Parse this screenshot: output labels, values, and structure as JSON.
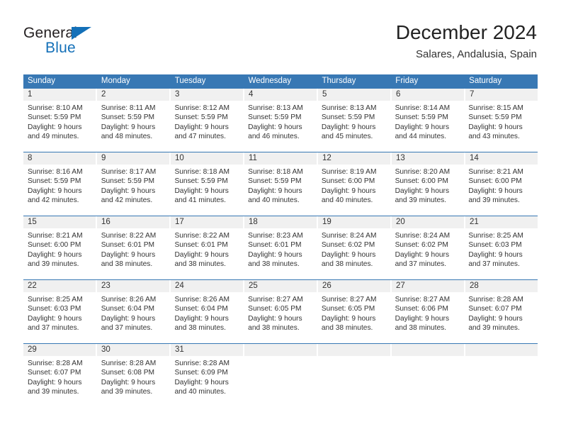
{
  "brand": {
    "name_dark": "General",
    "name_blue": "Blue",
    "triangle_color": "#1470b8"
  },
  "header": {
    "title": "December 2024",
    "subtitle": "Salares, Andalusia, Spain"
  },
  "colors": {
    "header_blue": "#3878b4",
    "daynum_gray": "#f0f0f0",
    "text": "#333333",
    "brand_blue": "#1470b8"
  },
  "weekdays": [
    "Sunday",
    "Monday",
    "Tuesday",
    "Wednesday",
    "Thursday",
    "Friday",
    "Saturday"
  ],
  "weeks": [
    {
      "days": [
        {
          "num": "1",
          "l1": "Sunrise: 8:10 AM",
          "l2": "Sunset: 5:59 PM",
          "l3": "Daylight: 9 hours",
          "l4": "and 49 minutes."
        },
        {
          "num": "2",
          "l1": "Sunrise: 8:11 AM",
          "l2": "Sunset: 5:59 PM",
          "l3": "Daylight: 9 hours",
          "l4": "and 48 minutes."
        },
        {
          "num": "3",
          "l1": "Sunrise: 8:12 AM",
          "l2": "Sunset: 5:59 PM",
          "l3": "Daylight: 9 hours",
          "l4": "and 47 minutes."
        },
        {
          "num": "4",
          "l1": "Sunrise: 8:13 AM",
          "l2": "Sunset: 5:59 PM",
          "l3": "Daylight: 9 hours",
          "l4": "and 46 minutes."
        },
        {
          "num": "5",
          "l1": "Sunrise: 8:13 AM",
          "l2": "Sunset: 5:59 PM",
          "l3": "Daylight: 9 hours",
          "l4": "and 45 minutes."
        },
        {
          "num": "6",
          "l1": "Sunrise: 8:14 AM",
          "l2": "Sunset: 5:59 PM",
          "l3": "Daylight: 9 hours",
          "l4": "and 44 minutes."
        },
        {
          "num": "7",
          "l1": "Sunrise: 8:15 AM",
          "l2": "Sunset: 5:59 PM",
          "l3": "Daylight: 9 hours",
          "l4": "and 43 minutes."
        }
      ]
    },
    {
      "days": [
        {
          "num": "8",
          "l1": "Sunrise: 8:16 AM",
          "l2": "Sunset: 5:59 PM",
          "l3": "Daylight: 9 hours",
          "l4": "and 42 minutes."
        },
        {
          "num": "9",
          "l1": "Sunrise: 8:17 AM",
          "l2": "Sunset: 5:59 PM",
          "l3": "Daylight: 9 hours",
          "l4": "and 42 minutes."
        },
        {
          "num": "10",
          "l1": "Sunrise: 8:18 AM",
          "l2": "Sunset: 5:59 PM",
          "l3": "Daylight: 9 hours",
          "l4": "and 41 minutes."
        },
        {
          "num": "11",
          "l1": "Sunrise: 8:18 AM",
          "l2": "Sunset: 5:59 PM",
          "l3": "Daylight: 9 hours",
          "l4": "and 40 minutes."
        },
        {
          "num": "12",
          "l1": "Sunrise: 8:19 AM",
          "l2": "Sunset: 6:00 PM",
          "l3": "Daylight: 9 hours",
          "l4": "and 40 minutes."
        },
        {
          "num": "13",
          "l1": "Sunrise: 8:20 AM",
          "l2": "Sunset: 6:00 PM",
          "l3": "Daylight: 9 hours",
          "l4": "and 39 minutes."
        },
        {
          "num": "14",
          "l1": "Sunrise: 8:21 AM",
          "l2": "Sunset: 6:00 PM",
          "l3": "Daylight: 9 hours",
          "l4": "and 39 minutes."
        }
      ]
    },
    {
      "days": [
        {
          "num": "15",
          "l1": "Sunrise: 8:21 AM",
          "l2": "Sunset: 6:00 PM",
          "l3": "Daylight: 9 hours",
          "l4": "and 39 minutes."
        },
        {
          "num": "16",
          "l1": "Sunrise: 8:22 AM",
          "l2": "Sunset: 6:01 PM",
          "l3": "Daylight: 9 hours",
          "l4": "and 38 minutes."
        },
        {
          "num": "17",
          "l1": "Sunrise: 8:22 AM",
          "l2": "Sunset: 6:01 PM",
          "l3": "Daylight: 9 hours",
          "l4": "and 38 minutes."
        },
        {
          "num": "18",
          "l1": "Sunrise: 8:23 AM",
          "l2": "Sunset: 6:01 PM",
          "l3": "Daylight: 9 hours",
          "l4": "and 38 minutes."
        },
        {
          "num": "19",
          "l1": "Sunrise: 8:24 AM",
          "l2": "Sunset: 6:02 PM",
          "l3": "Daylight: 9 hours",
          "l4": "and 38 minutes."
        },
        {
          "num": "20",
          "l1": "Sunrise: 8:24 AM",
          "l2": "Sunset: 6:02 PM",
          "l3": "Daylight: 9 hours",
          "l4": "and 37 minutes."
        },
        {
          "num": "21",
          "l1": "Sunrise: 8:25 AM",
          "l2": "Sunset: 6:03 PM",
          "l3": "Daylight: 9 hours",
          "l4": "and 37 minutes."
        }
      ]
    },
    {
      "days": [
        {
          "num": "22",
          "l1": "Sunrise: 8:25 AM",
          "l2": "Sunset: 6:03 PM",
          "l3": "Daylight: 9 hours",
          "l4": "and 37 minutes."
        },
        {
          "num": "23",
          "l1": "Sunrise: 8:26 AM",
          "l2": "Sunset: 6:04 PM",
          "l3": "Daylight: 9 hours",
          "l4": "and 37 minutes."
        },
        {
          "num": "24",
          "l1": "Sunrise: 8:26 AM",
          "l2": "Sunset: 6:04 PM",
          "l3": "Daylight: 9 hours",
          "l4": "and 38 minutes."
        },
        {
          "num": "25",
          "l1": "Sunrise: 8:27 AM",
          "l2": "Sunset: 6:05 PM",
          "l3": "Daylight: 9 hours",
          "l4": "and 38 minutes."
        },
        {
          "num": "26",
          "l1": "Sunrise: 8:27 AM",
          "l2": "Sunset: 6:05 PM",
          "l3": "Daylight: 9 hours",
          "l4": "and 38 minutes."
        },
        {
          "num": "27",
          "l1": "Sunrise: 8:27 AM",
          "l2": "Sunset: 6:06 PM",
          "l3": "Daylight: 9 hours",
          "l4": "and 38 minutes."
        },
        {
          "num": "28",
          "l1": "Sunrise: 8:28 AM",
          "l2": "Sunset: 6:07 PM",
          "l3": "Daylight: 9 hours",
          "l4": "and 39 minutes."
        }
      ]
    },
    {
      "days": [
        {
          "num": "29",
          "l1": "Sunrise: 8:28 AM",
          "l2": "Sunset: 6:07 PM",
          "l3": "Daylight: 9 hours",
          "l4": "and 39 minutes."
        },
        {
          "num": "30",
          "l1": "Sunrise: 8:28 AM",
          "l2": "Sunset: 6:08 PM",
          "l3": "Daylight: 9 hours",
          "l4": "and 39 minutes."
        },
        {
          "num": "31",
          "l1": "Sunrise: 8:28 AM",
          "l2": "Sunset: 6:09 PM",
          "l3": "Daylight: 9 hours",
          "l4": "and 40 minutes."
        },
        {
          "num": "",
          "l1": "",
          "l2": "",
          "l3": "",
          "l4": ""
        },
        {
          "num": "",
          "l1": "",
          "l2": "",
          "l3": "",
          "l4": ""
        },
        {
          "num": "",
          "l1": "",
          "l2": "",
          "l3": "",
          "l4": ""
        },
        {
          "num": "",
          "l1": "",
          "l2": "",
          "l3": "",
          "l4": ""
        }
      ]
    }
  ]
}
